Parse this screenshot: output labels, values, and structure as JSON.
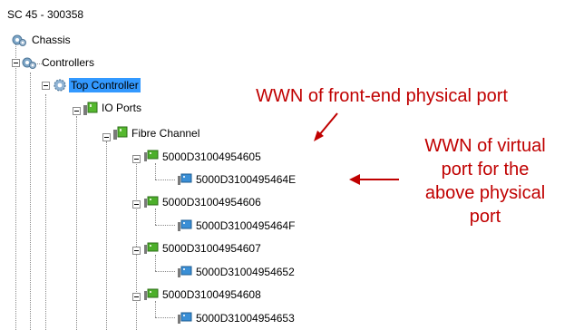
{
  "tree": {
    "root_label": "SC 45 - 300358",
    "chassis_label": "Chassis",
    "controllers_label": "Controllers",
    "top_controller_label": "Top Controller",
    "io_ports_label": "IO Ports",
    "fibre_channel_label": "Fibre Channel",
    "ports": [
      {
        "physical": "5000D31004954605",
        "virtual": "5000D3100495464E"
      },
      {
        "physical": "5000D31004954606",
        "virtual": "5000D3100495464F"
      },
      {
        "physical": "5000D31004954607",
        "virtual": "5000D31004954652"
      },
      {
        "physical": "5000D31004954608",
        "virtual": "5000D31004954653"
      }
    ]
  },
  "annotations": {
    "front_end": "WWN of front-end physical port",
    "virtual_lines": [
      "WWN of virtual",
      "port for the",
      "above physical",
      "port"
    ]
  },
  "colors": {
    "annotation": "#c00000",
    "selection": "#3399ff",
    "physical_port_icon": "#4caf2a",
    "virtual_port_icon": "#3a8fd6"
  }
}
